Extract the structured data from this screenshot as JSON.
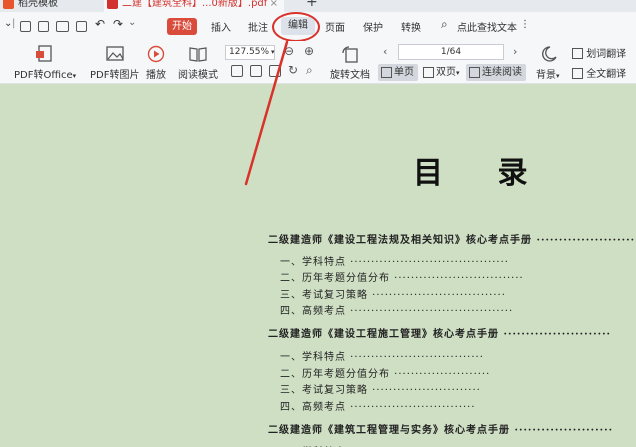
{
  "tabs": [
    {
      "label": "稻壳模板"
    },
    {
      "label": "二建【建筑全科】...0新版】.pdf"
    }
  ],
  "menu": {
    "start": "开始",
    "insert": "插入",
    "annotate": "批注",
    "edit": "编辑",
    "page": "页面",
    "protect": "保护",
    "convert": "转换",
    "search_placeholder": "点此查找文本"
  },
  "toolbar": {
    "pdf_to_office": "PDF转Office",
    "pdf_to_image": "PDF转图片",
    "play": "播放",
    "read_mode": "阅读模式",
    "zoom": "127.55%",
    "rotate": "旋转文档",
    "page_indicator": "1/64",
    "single_page": "单页",
    "double_page": "双页",
    "continuous": "连续阅读",
    "background": "背景",
    "word_translate": "划词翻译",
    "full_translate": "全文翻译"
  },
  "document": {
    "title": "目 录",
    "toc": [
      {
        "level": "section",
        "text": "二级建造师《建设工程法规及相关知识》核心考点手册 ··························"
      },
      {
        "level": "item",
        "text": "一、学科特点 ······································"
      },
      {
        "level": "item",
        "text": "二、历年考题分值分布 ·······························"
      },
      {
        "level": "item",
        "text": "三、考试复习策略 ································"
      },
      {
        "level": "item",
        "text": "四、高频考点 ·······································"
      },
      {
        "level": "section",
        "text": "二级建造师《建设工程施工管理》核心考点手册 ························"
      },
      {
        "level": "item",
        "text": "一、学科特点 ································"
      },
      {
        "level": "item",
        "text": "二、历年考题分值分布 ·······················"
      },
      {
        "level": "item",
        "text": "三、考试复习策略 ··························"
      },
      {
        "level": "item",
        "text": "四、高频考点 ······························"
      },
      {
        "level": "section",
        "text": "二级建造师《建筑工程管理与实务》核心考点手册 ······················"
      },
      {
        "level": "item",
        "text": "一、学科特点 ······························"
      }
    ]
  },
  "colors": {
    "accent_red": "#d94c3c",
    "annotation_red": "#d9322a",
    "page_background": "#cfdfc4"
  }
}
